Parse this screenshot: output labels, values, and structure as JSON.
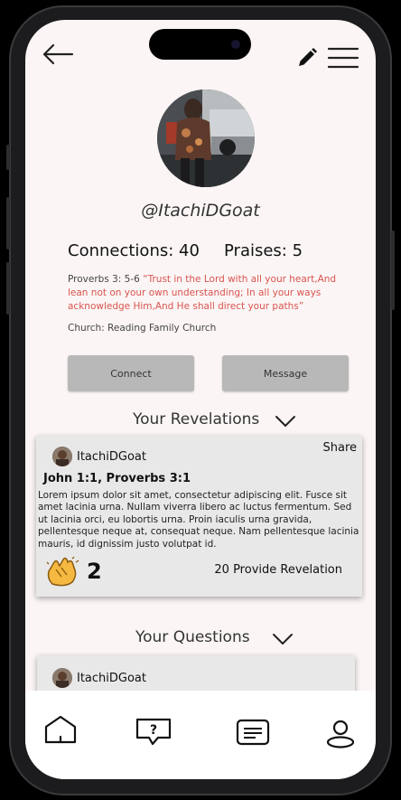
{
  "header": {
    "back_icon": "arrow-left-icon",
    "edit_icon": "pencil-icon",
    "menu_icon": "hamburger-menu-icon"
  },
  "profile": {
    "username": "@ItachiDGoat",
    "connections_label": "Connections: 40",
    "praises_label": "Praises: 5",
    "verse_ref": "Proverbs 3: 5-6",
    "verse_text": "“Trust in the Lord with all your heart,And lean not on your own understanding; In all your ways acknowledge Him,And He shall direct your paths”",
    "church": "Church: Reading Family Church",
    "connect_label": "Connect",
    "message_label": "Message"
  },
  "revelations": {
    "title": "Your Revelations",
    "card": {
      "user": "ItachiDGoat",
      "share_label": "Share",
      "refs": "John 1:1, Proverbs 3:1",
      "body": "Lorem ipsum dolor sit amet, consectetur adipiscing elit. Fusce sit amet lacinia urna. Nullam viverra libero ac luctus fermentum. Sed ut lacinia orci, eu lobortis urna. Proin iaculis urna gravida, pellentesque neque at, consequat neque. Nam pellentesque lacinia mauris, id dignissim justo volutpat id.",
      "clap_count": "2",
      "provide_label": "20 Provide Revelation"
    }
  },
  "questions": {
    "title": "Your Questions",
    "card": {
      "user": "ItachiDGoat"
    }
  },
  "tabbar": {
    "items": [
      "home-icon",
      "question-chat-icon",
      "message-icon",
      "profile-icon"
    ]
  },
  "colors": {
    "background": "#fbf6f5",
    "quote": "#d9534f",
    "button": "#b8b8b8",
    "card": "#e8e8e8"
  }
}
